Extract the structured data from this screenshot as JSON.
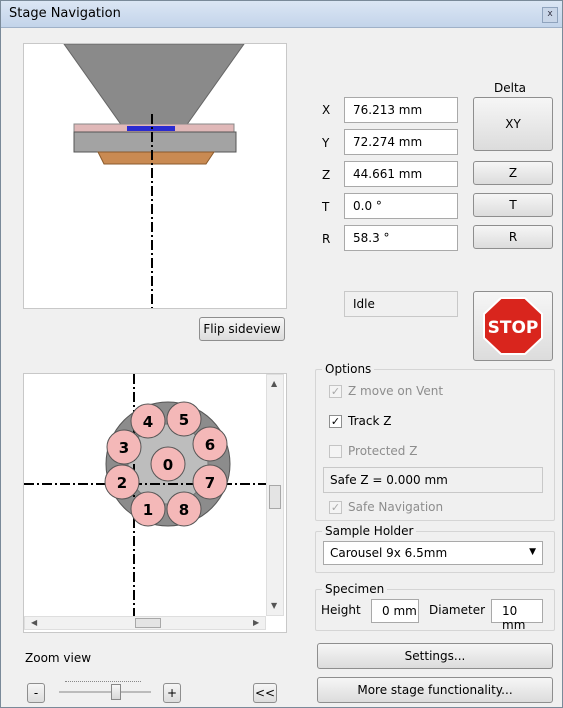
{
  "window": {
    "title": "Stage Navigation",
    "close_glyph": "x"
  },
  "delta": {
    "header": "Delta",
    "xy_label": "XY",
    "z_label": "Z",
    "t_label": "T",
    "r_label": "R"
  },
  "coords": [
    {
      "axis": "X",
      "value": "76.213 mm"
    },
    {
      "axis": "Y",
      "value": "72.274 mm"
    },
    {
      "axis": "Z",
      "value": "44.661 mm"
    },
    {
      "axis": "T",
      "value": "0.0 °"
    },
    {
      "axis": "R",
      "value": "58.3 °"
    }
  ],
  "status": "Idle",
  "stop_label": "STOP",
  "flip_label": "Flip sideview",
  "options": {
    "title": "Options",
    "z_move_on_vent": {
      "label": "Z move on Vent",
      "checked": true,
      "enabled": false
    },
    "track_z": {
      "label": "Track Z",
      "checked": true,
      "enabled": true
    },
    "protected_z": {
      "label": "Protected Z",
      "checked": false,
      "enabled": false
    },
    "safe_z": "Safe Z =  0.000 mm",
    "safe_navigation": {
      "label": "Safe Navigation",
      "checked": true,
      "enabled": false
    }
  },
  "sample_holder": {
    "title": "Sample Holder",
    "selected": "Carousel 9x 6.5mm"
  },
  "specimen": {
    "title": "Specimen",
    "height_label": "Height",
    "height_value": "0 mm",
    "diameter_label": "Diameter",
    "diameter_value": "10 mm"
  },
  "carousel": {
    "slots": [
      "0",
      "1",
      "2",
      "3",
      "4",
      "5",
      "6",
      "7",
      "8"
    ]
  },
  "zoom": {
    "label": "Zoom view",
    "minus": "-",
    "plus": "+",
    "collapse": "<<"
  },
  "buttons": {
    "settings": "Settings...",
    "more": "More stage functionality..."
  },
  "colors": {
    "stop_red": "#d9251d",
    "slot_pink": "#f4b8b8",
    "stage_gray": "#8c8c8c",
    "copper": "#c98a52"
  }
}
